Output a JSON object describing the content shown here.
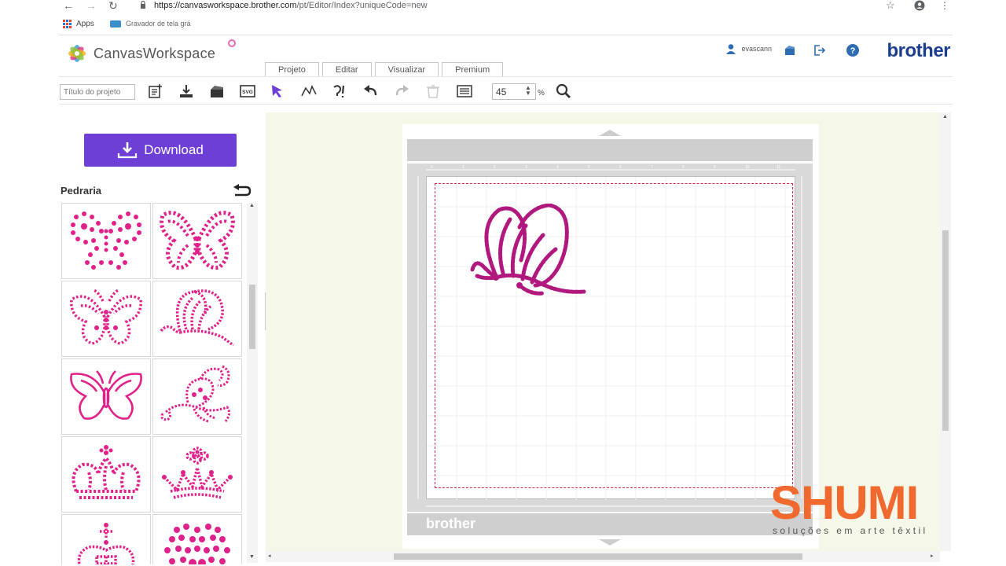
{
  "browser": {
    "url_host": "https://canvasworkspace.brother.com",
    "url_path": "/pt/Editor/Index?uniqueCode=new",
    "bookmarks": [
      "Apps",
      "Gravador de tela grá"
    ]
  },
  "app": {
    "logo_text": "CanvasWorkspace",
    "tabs": [
      "Projeto",
      "Editar",
      "Visualizar",
      "Premium"
    ],
    "username": "evascann",
    "brand": "brother"
  },
  "toolbar": {
    "project_title_placeholder": "Título do projeto",
    "zoom_value": "45",
    "zoom_unit": "%"
  },
  "left_panel": {
    "download_label": "Download",
    "section_title": "Pedraria",
    "items": [
      "rhinestone-butterfly-1",
      "rhinestone-butterfly-2",
      "rhinestone-butterfly-3",
      "rhinestone-butterfly-4",
      "rhinestone-butterfly-5",
      "rhinestone-butterfly-6",
      "rhinestone-crown-1",
      "rhinestone-crown-2",
      "rhinestone-crown-3",
      "rhinestone-pattern"
    ]
  },
  "mat": {
    "brand": "brother",
    "design_color": "#b0187e"
  },
  "watermark": {
    "title": "SHUMI",
    "subtitle": "soluções em arte têxtil"
  },
  "colors": {
    "accent": "#6d3fd6",
    "pink": "#e0218a",
    "brand_blue": "#1c3e8e",
    "watermark": "#f06a2f"
  }
}
